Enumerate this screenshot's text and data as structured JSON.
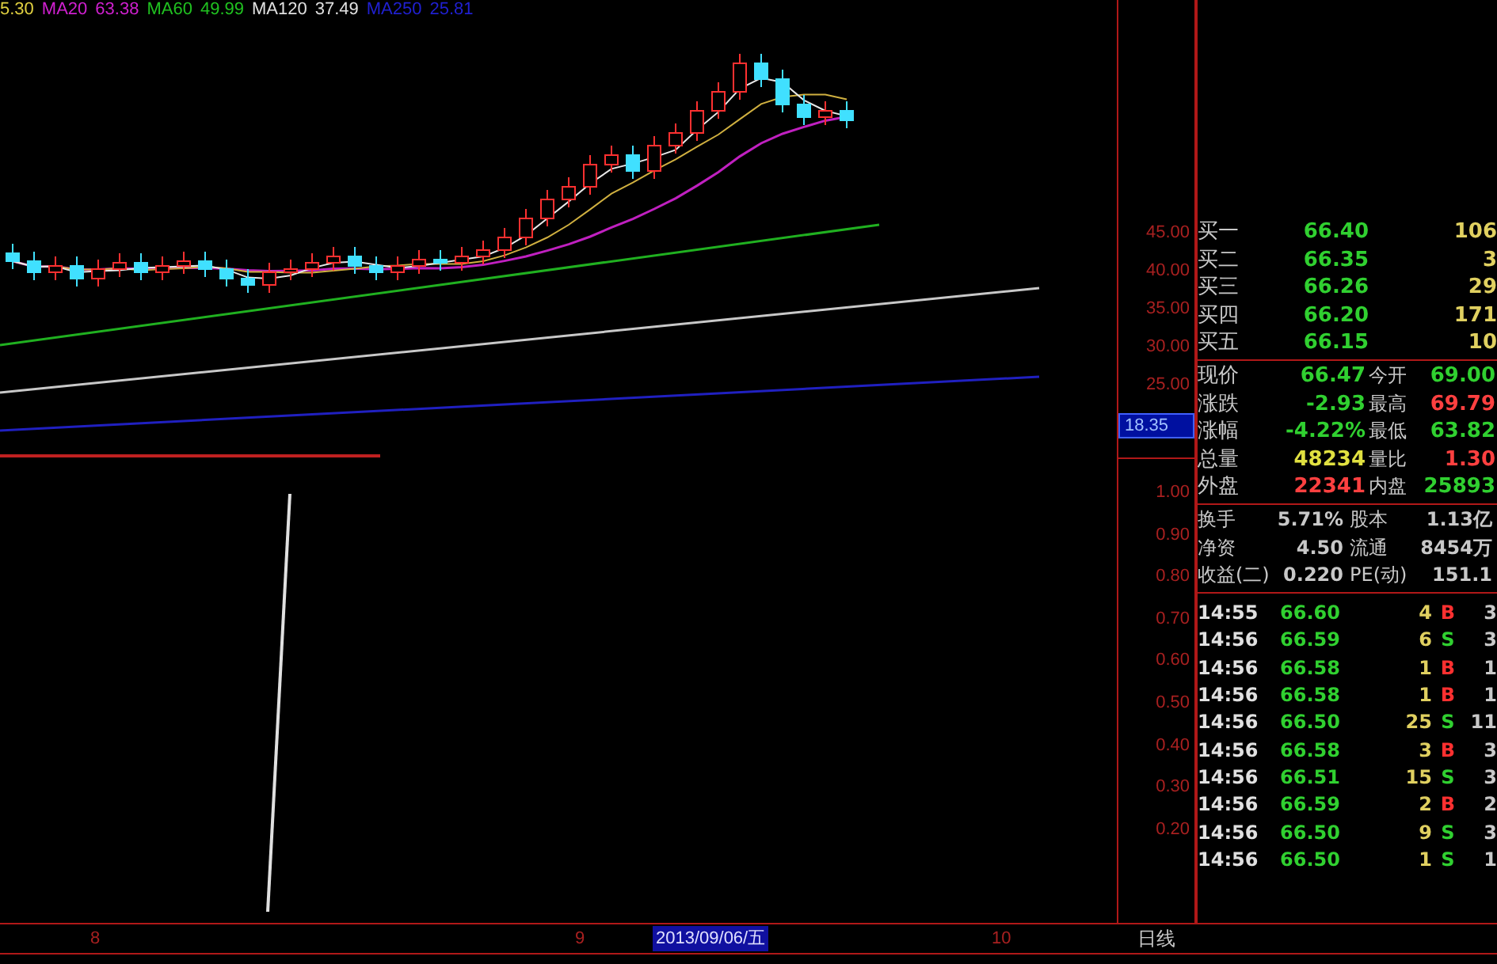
{
  "legend": [
    {
      "text": "5.30",
      "color": "#e0d040"
    },
    {
      "text": "MA20",
      "color": "#d020d0"
    },
    {
      "text": "63.38",
      "color": "#d020d0"
    },
    {
      "text": "MA60",
      "color": "#20c020"
    },
    {
      "text": "49.99",
      "color": "#20c020"
    },
    {
      "text": "MA120",
      "color": "#e0e0e0"
    },
    {
      "text": "37.49",
      "color": "#e0e0e0"
    },
    {
      "text": "MA250",
      "color": "#2020d0"
    },
    {
      "text": "25.81",
      "color": "#2020d0"
    }
  ],
  "upper_axis": {
    "ticks": [
      "45.00",
      "40.00",
      "35.00",
      "30.00",
      "25.00"
    ],
    "price_box": "18.35"
  },
  "lower_axis": {
    "ticks": [
      "1.00",
      "0.90",
      "0.80",
      "0.70",
      "0.60",
      "0.50",
      "0.40",
      "0.30",
      "0.20"
    ]
  },
  "bids": [
    {
      "label": "买一",
      "price": "66.40",
      "volume": "106"
    },
    {
      "label": "买二",
      "price": "66.35",
      "volume": "3"
    },
    {
      "label": "买三",
      "price": "66.26",
      "volume": "29"
    },
    {
      "label": "买四",
      "price": "66.20",
      "volume": "171"
    },
    {
      "label": "买五",
      "price": "66.15",
      "volume": "10"
    }
  ],
  "stats": [
    {
      "label": "现价",
      "value": "66.47",
      "color": "#30d030"
    },
    {
      "label": "今开",
      "value": "69.00",
      "color": "#30d030"
    },
    {
      "label": "涨跌",
      "value": "-2.93",
      "color": "#30d030"
    },
    {
      "label": "最高",
      "value": "69.79",
      "color": "#ff4040"
    },
    {
      "label": "涨幅",
      "value": "-4.22%",
      "color": "#30d030"
    },
    {
      "label": "最低",
      "value": "63.82",
      "color": "#30d030"
    },
    {
      "label": "总量",
      "value": "48234",
      "color": "#e0e040"
    },
    {
      "label": "量比",
      "value": "1.30",
      "color": "#ff4040"
    },
    {
      "label": "外盘",
      "value": "22341",
      "color": "#ff4040"
    },
    {
      "label": "内盘",
      "value": "25893",
      "color": "#30d030"
    }
  ],
  "fundamentals": [
    {
      "label": "换手",
      "value": "5.71%"
    },
    {
      "label": "股本",
      "value": "1.13亿"
    },
    {
      "label": "净资",
      "value": "4.50"
    },
    {
      "label": "流通",
      "value": "8454万"
    },
    {
      "label": "收益(二)",
      "value": "0.220"
    },
    {
      "label": "PE(动)",
      "value": "151.1"
    }
  ],
  "trades": [
    {
      "time": "14:55",
      "price": "66.60",
      "volume": "4",
      "side": "B",
      "color": "#ff3030",
      "column_5": "3"
    },
    {
      "time": "14:56",
      "price": "66.59",
      "volume": "6",
      "side": "S",
      "color": "#30d030",
      "column_5": "3"
    },
    {
      "time": "14:56",
      "price": "66.58",
      "volume": "1",
      "side": "B",
      "color": "#ff3030",
      "column_5": "1"
    },
    {
      "time": "14:56",
      "price": "66.58",
      "volume": "1",
      "side": "B",
      "color": "#ff3030",
      "column_5": "1"
    },
    {
      "time": "14:56",
      "price": "66.50",
      "volume": "25",
      "side": "S",
      "color": "#30d030",
      "column_5": "11"
    },
    {
      "time": "14:56",
      "price": "66.58",
      "volume": "3",
      "side": "B",
      "color": "#ff3030",
      "column_5": "3"
    },
    {
      "time": "14:56",
      "price": "66.51",
      "volume": "15",
      "side": "S",
      "color": "#30d030",
      "column_5": "3"
    },
    {
      "time": "14:56",
      "price": "66.59",
      "volume": "2",
      "side": "B",
      "color": "#ff3030",
      "column_5": "2"
    },
    {
      "time": "14:56",
      "price": "66.50",
      "volume": "9",
      "side": "S",
      "color": "#30d030",
      "column_5": "3"
    },
    {
      "time": "14:56",
      "price": "66.50",
      "volume": "1",
      "side": "S",
      "color": "#30d030",
      "column_5": "1"
    }
  ],
  "date_axis": {
    "labels": [
      "8",
      "9",
      "10"
    ],
    "cursor_date": "2013/09/06/五",
    "period": "日线"
  }
}
